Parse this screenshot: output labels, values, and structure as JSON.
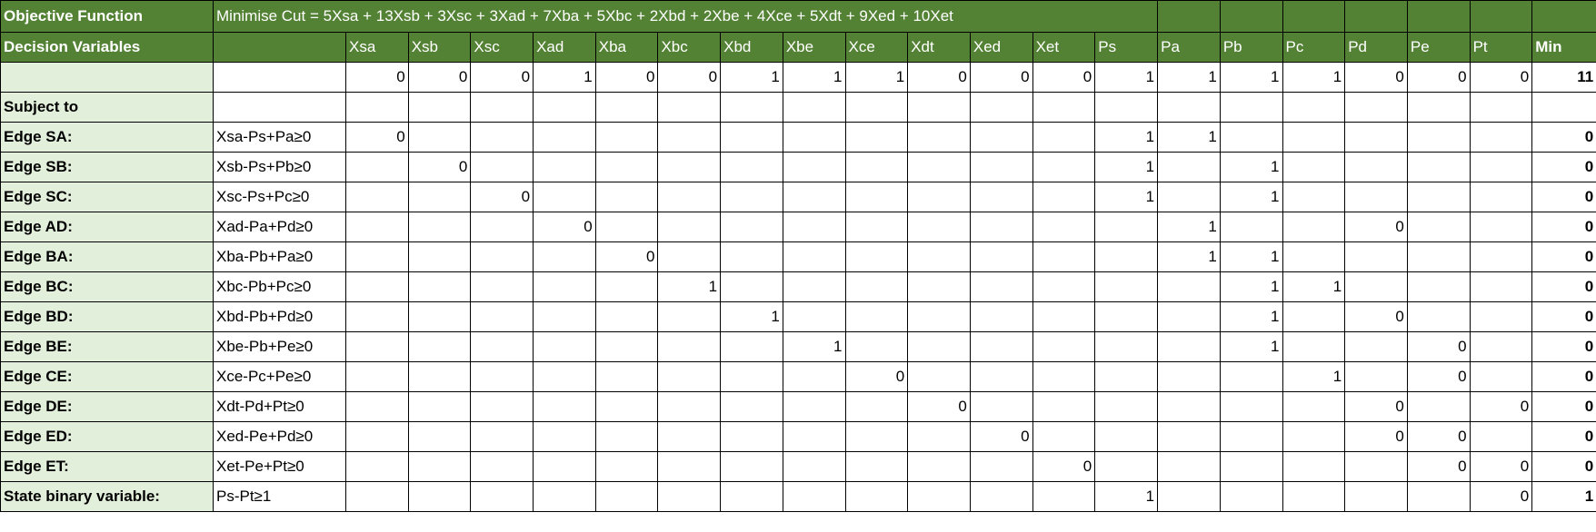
{
  "colors": {
    "header_green": "#548235",
    "label_light_green": "#e2efda",
    "border": "#000000"
  },
  "objective": {
    "label": "Objective Function",
    "formula": "Minimise Cut = 5Xsa + 13Xsb + 3Xsc + 3Xad + 7Xba + 5Xbc + 2Xbd + 2Xbe + 4Xce + 5Xdt + 9Xed + 10Xet"
  },
  "decision": {
    "label": "Decision Variables",
    "columns": [
      "Xsa",
      "Xsb",
      "Xsc",
      "Xad",
      "Xba",
      "Xbc",
      "Xbd",
      "Xbe",
      "Xce",
      "Xdt",
      "Xed",
      "Xet",
      "Ps",
      "Pa",
      "Pb",
      "Pc",
      "Pd",
      "Pe",
      "Pt"
    ],
    "min_label": "Min"
  },
  "solution": {
    "label": "",
    "desc": "",
    "values": [
      "0",
      "0",
      "0",
      "1",
      "0",
      "0",
      "1",
      "1",
      "1",
      "0",
      "0",
      "0",
      "1",
      "1",
      "1",
      "1",
      "0",
      "0",
      "0"
    ],
    "min": "11"
  },
  "subject": {
    "label": "Subject to"
  },
  "constraints": [
    {
      "label": "Edge SA:",
      "desc": "Xsa-Ps+Pa≥0",
      "values": [
        "0",
        "",
        "",
        "",
        "",
        "",
        "",
        "",
        "",
        "",
        "",
        "",
        "1",
        "1",
        "",
        "",
        "",
        "",
        ""
      ],
      "min": "0"
    },
    {
      "label": "Edge SB:",
      "desc": "Xsb-Ps+Pb≥0",
      "values": [
        "",
        "0",
        "",
        "",
        "",
        "",
        "",
        "",
        "",
        "",
        "",
        "",
        "1",
        "",
        "1",
        "",
        "",
        "",
        ""
      ],
      "min": "0"
    },
    {
      "label": "Edge SC:",
      "desc": "Xsc-Ps+Pc≥0",
      "values": [
        "",
        "",
        "0",
        "",
        "",
        "",
        "",
        "",
        "",
        "",
        "",
        "",
        "1",
        "",
        "1",
        "",
        "",
        "",
        ""
      ],
      "min": "0"
    },
    {
      "label": "Edge AD:",
      "desc": "Xad-Pa+Pd≥0",
      "values": [
        "",
        "",
        "",
        "0",
        "",
        "",
        "",
        "",
        "",
        "",
        "",
        "",
        "",
        "1",
        "",
        "",
        "0",
        "",
        ""
      ],
      "min": "0"
    },
    {
      "label": "Edge BA:",
      "desc": "Xba-Pb+Pa≥0",
      "values": [
        "",
        "",
        "",
        "",
        "0",
        "",
        "",
        "",
        "",
        "",
        "",
        "",
        "",
        "1",
        "1",
        "",
        "",
        "",
        ""
      ],
      "min": "0"
    },
    {
      "label": "Edge BC:",
      "desc": "Xbc-Pb+Pc≥0",
      "values": [
        "",
        "",
        "",
        "",
        "",
        "1",
        "",
        "",
        "",
        "",
        "",
        "",
        "",
        "",
        "1",
        "1",
        "",
        "",
        ""
      ],
      "min": "0"
    },
    {
      "label": "Edge BD:",
      "desc": "Xbd-Pb+Pd≥0",
      "values": [
        "",
        "",
        "",
        "",
        "",
        "",
        "1",
        "",
        "",
        "",
        "",
        "",
        "",
        "",
        "1",
        "",
        "0",
        "",
        ""
      ],
      "min": "0"
    },
    {
      "label": "Edge BE:",
      "desc": "Xbe-Pb+Pe≥0",
      "values": [
        "",
        "",
        "",
        "",
        "",
        "",
        "",
        "1",
        "",
        "",
        "",
        "",
        "",
        "",
        "1",
        "",
        "",
        "0",
        ""
      ],
      "min": "0"
    },
    {
      "label": "Edge CE:",
      "desc": "Xce-Pc+Pe≥0",
      "values": [
        "",
        "",
        "",
        "",
        "",
        "",
        "",
        "",
        "0",
        "",
        "",
        "",
        "",
        "",
        "",
        "1",
        "",
        "0",
        ""
      ],
      "min": "0"
    },
    {
      "label": "Edge DE:",
      "desc": "Xdt-Pd+Pt≥0",
      "values": [
        "",
        "",
        "",
        "",
        "",
        "",
        "",
        "",
        "",
        "0",
        "",
        "",
        "",
        "",
        "",
        "",
        "0",
        "",
        "0"
      ],
      "min": "0"
    },
    {
      "label": "Edge ED:",
      "desc": "Xed-Pe+Pd≥0",
      "values": [
        "",
        "",
        "",
        "",
        "",
        "",
        "",
        "",
        "",
        "",
        "0",
        "",
        "",
        "",
        "",
        "",
        "0",
        "0",
        ""
      ],
      "min": "0"
    },
    {
      "label": "Edge ET:",
      "desc": "Xet-Pe+Pt≥0",
      "values": [
        "",
        "",
        "",
        "",
        "",
        "",
        "",
        "",
        "",
        "",
        "",
        "0",
        "",
        "",
        "",
        "",
        "",
        "0",
        "0"
      ],
      "min": "0"
    },
    {
      "label": "State binary variable:",
      "desc": "Ps-Pt≥1",
      "values": [
        "",
        "",
        "",
        "",
        "",
        "",
        "",
        "",
        "",
        "",
        "",
        "",
        "1",
        "",
        "",
        "",
        "",
        "",
        "0"
      ],
      "min": "1"
    }
  ]
}
